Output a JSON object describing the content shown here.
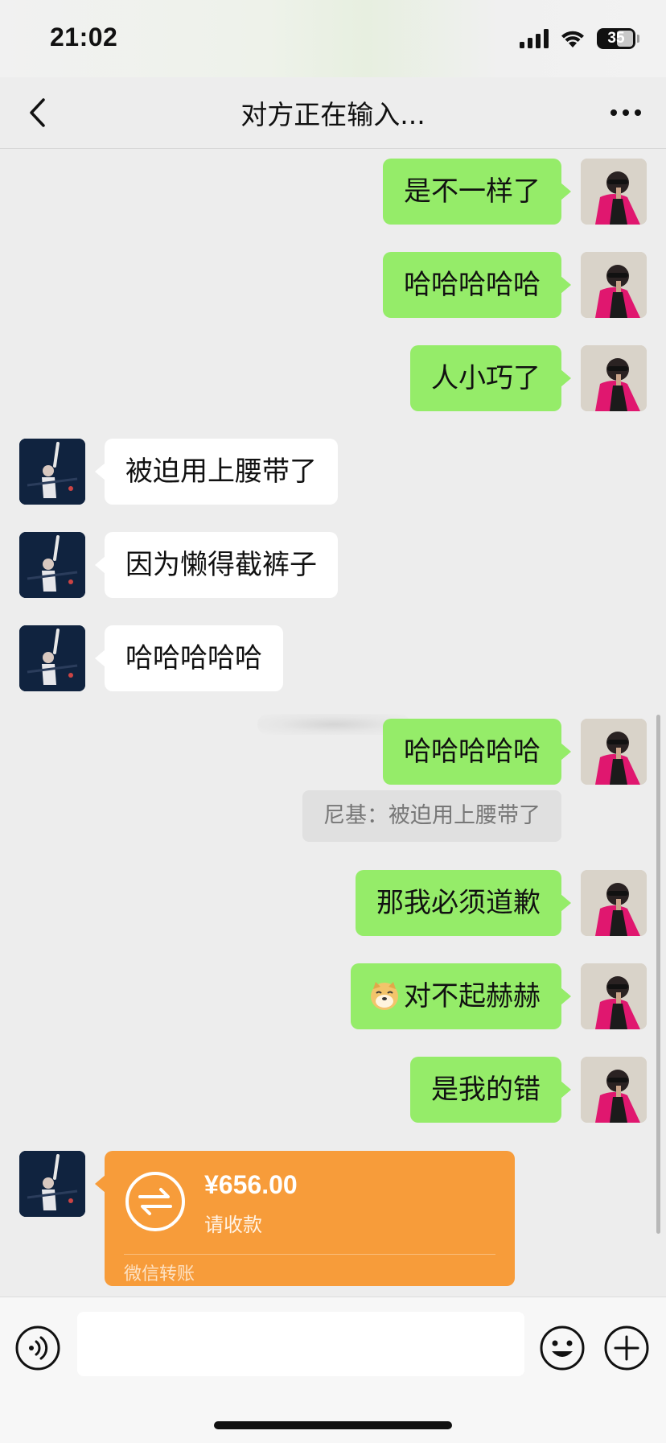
{
  "status_bar": {
    "time": "21:02",
    "battery": "35",
    "icons": [
      "cellular-signal-icon",
      "wifi-icon",
      "battery-icon"
    ]
  },
  "nav": {
    "title": "对方正在输入...",
    "back_icon": "chevron-left-icon",
    "more_icon": "more-dots-icon"
  },
  "messages": [
    {
      "side": "self",
      "text": "是不一样了"
    },
    {
      "side": "self",
      "text": "哈哈哈哈哈"
    },
    {
      "side": "self",
      "text": "人小巧了"
    },
    {
      "side": "other",
      "text": "被迫用上腰带了"
    },
    {
      "side": "other",
      "text": "因为懒得截裤子"
    },
    {
      "side": "other",
      "text": "哈哈哈哈哈"
    },
    {
      "side": "self",
      "text": "哈哈哈哈哈"
    },
    {
      "side": "quote",
      "text": "尼基：被迫用上腰带了"
    },
    {
      "side": "self",
      "text": "那我必须道歉"
    },
    {
      "side": "self",
      "text": "对不起赫赫",
      "emoji": "doge-emoji"
    },
    {
      "side": "self",
      "text": "是我的错"
    }
  ],
  "transfer": {
    "amount": "¥656.00",
    "status": "请收款",
    "footer": "微信转账",
    "color": "#f79c3a",
    "icon": "transfer-arrows-icon"
  },
  "input_bar": {
    "value": "",
    "voice_icon": "voice-icon",
    "emoji_icon": "emoji-smile-icon",
    "plus_icon": "plus-circle-icon"
  },
  "colors": {
    "self_bubble": "#95ec69",
    "other_bubble": "#ffffff",
    "background": "#ededed"
  }
}
